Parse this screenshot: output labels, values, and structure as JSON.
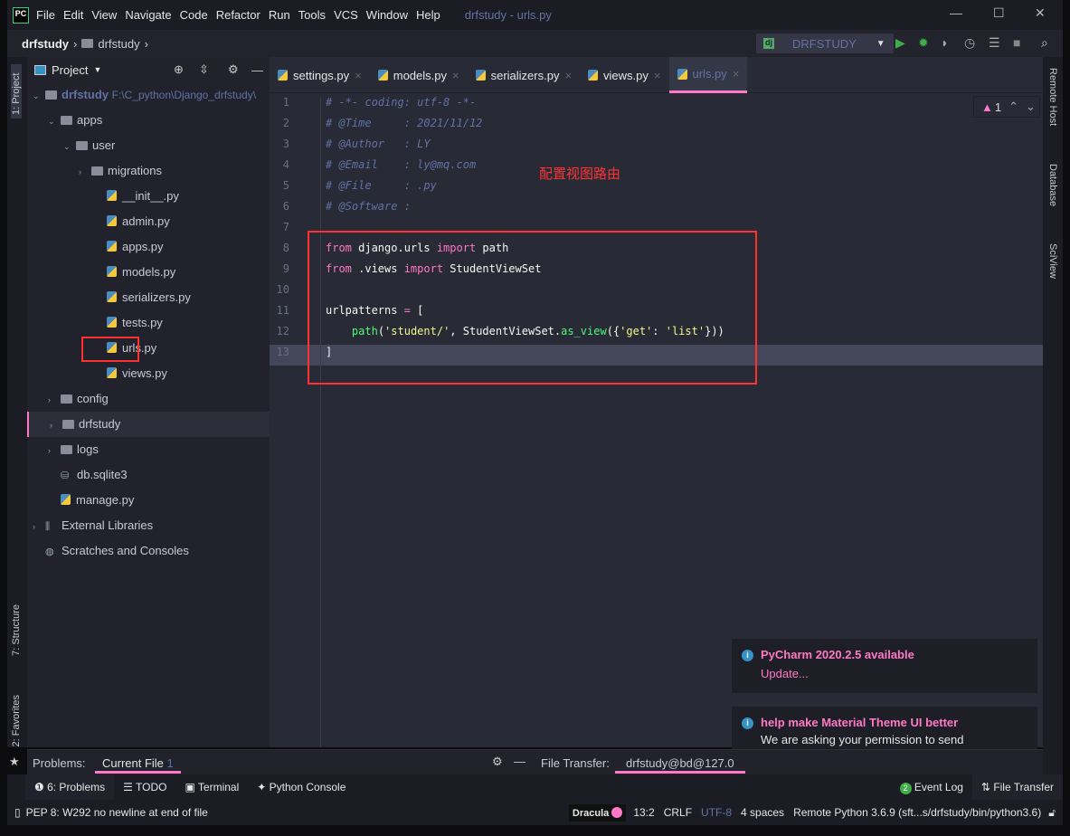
{
  "title_bar": {
    "logo": "PC",
    "menu": [
      "File",
      "Edit",
      "View",
      "Navigate",
      "Code",
      "Refactor",
      "Run",
      "Tools",
      "VCS",
      "Window",
      "Help"
    ],
    "window_title": "drfstudy - urls.py"
  },
  "nav": {
    "breadcrumb": [
      "drfstudy",
      "drfstudy"
    ],
    "run_config": "DRFSTUDY"
  },
  "left_strip": {
    "project": "1: Project",
    "structure": "7: Structure",
    "favorites": "2: Favorites"
  },
  "right_strip": [
    "Remote Host",
    "Database",
    "SciView"
  ],
  "project": {
    "header": "Project",
    "root": "drfstudy",
    "root_path": "F:\\C_python\\Django_drfstudy\\",
    "items": [
      {
        "label": "apps",
        "type": "folder"
      },
      {
        "label": "user",
        "type": "folder"
      },
      {
        "label": "migrations",
        "type": "folder"
      },
      {
        "label": "__init__.py",
        "type": "py"
      },
      {
        "label": "admin.py",
        "type": "py"
      },
      {
        "label": "apps.py",
        "type": "py"
      },
      {
        "label": "models.py",
        "type": "py"
      },
      {
        "label": "serializers.py",
        "type": "py"
      },
      {
        "label": "tests.py",
        "type": "py"
      },
      {
        "label": "urls.py",
        "type": "py"
      },
      {
        "label": "views.py",
        "type": "py"
      },
      {
        "label": "config",
        "type": "folder"
      },
      {
        "label": "drfstudy",
        "type": "folder"
      },
      {
        "label": "logs",
        "type": "folder"
      },
      {
        "label": "db.sqlite3",
        "type": "db"
      },
      {
        "label": "manage.py",
        "type": "py"
      },
      {
        "label": "External Libraries",
        "type": "lib"
      },
      {
        "label": "Scratches and Consoles",
        "type": "scratch"
      }
    ]
  },
  "tabs": [
    "settings.py",
    "models.py",
    "serializers.py",
    "views.py",
    "urls.py"
  ],
  "active_tab": "urls.py",
  "inspection": {
    "warnings": "1"
  },
  "annotation": "配置视图路由",
  "code_lines": [
    "# -*- coding: utf-8 -*-",
    "# @Time     : 2021/11/12",
    "# @Author   : LY",
    "# @Email    : ly@mq.com",
    "# @File     : .py",
    "# @Software :",
    "",
    "from django.urls import path",
    "from .views import StudentViewSet",
    "",
    "urlpatterns = [",
    "    path('student/', StudentViewSet.as_view({'get': 'list'}))",
    "]"
  ],
  "problems": {
    "label": "Problems:",
    "tab": "Current File",
    "count": "1"
  },
  "file_transfer": {
    "label": "File Transfer:",
    "tab": "drfstudy@bd@127.0"
  },
  "toolwindows": [
    "6: Problems",
    "TODO",
    "Terminal",
    "Python Console"
  ],
  "event_log": {
    "count": "2",
    "label": "Event Log"
  },
  "file_transfer_btn": "File Transfer",
  "notifications": [
    {
      "title": "PyCharm 2020.2.5 available",
      "link": "Update..."
    },
    {
      "title": "help make Material Theme UI better",
      "body": "We are asking your permission to send information about your configuration (what..."
    }
  ],
  "status": {
    "message": "PEP 8: W292 no newline at end of file",
    "theme": "Dracula",
    "position": "13:2",
    "line_sep": "CRLF",
    "encoding": "UTF-8",
    "indent": "4 spaces",
    "interpreter": "Remote Python 3.6.9 (sft...s/drfstudy/bin/python3.6)"
  },
  "colors": {
    "accent": "#ff79c6",
    "editor_bg": "#282a36",
    "highlight": "#ff3030"
  }
}
